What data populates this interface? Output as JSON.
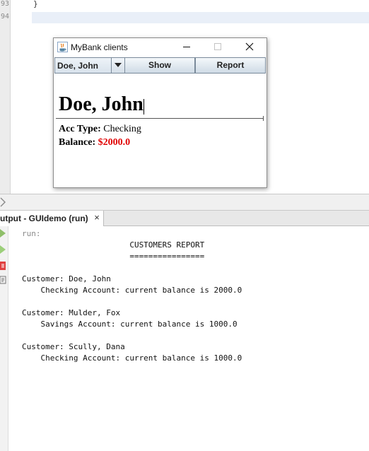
{
  "editor": {
    "line_numbers": [
      "93",
      "94"
    ],
    "code_line_93": "}"
  },
  "output_panel": {
    "tab_label": "utput - GUIdemo (run)",
    "tab_close": "×",
    "run_label": "run:",
    "lines": [
      "                       CUSTOMERS REPORT",
      "                       ================",
      "",
      "Customer: Doe, John",
      "    Checking Account: current balance is 2000.0",
      "",
      "Customer: Mulder, Fox",
      "    Savings Account: current balance is 1000.0",
      "",
      "Customer: Scully, Dana",
      "    Checking Account: current balance is 1000.0"
    ]
  },
  "window": {
    "title": "MyBank clients",
    "combo_selected": "Doe, John",
    "show_label": "Show",
    "report_label": "Report",
    "client_name": "Doe, John",
    "acc_type_label": "Acc Type:",
    "acc_type_value": "Checking",
    "balance_label": "Balance:",
    "balance_value": "$2000.0"
  },
  "colors": {
    "balance": "#e00000",
    "current_line": "#e9eff8"
  }
}
